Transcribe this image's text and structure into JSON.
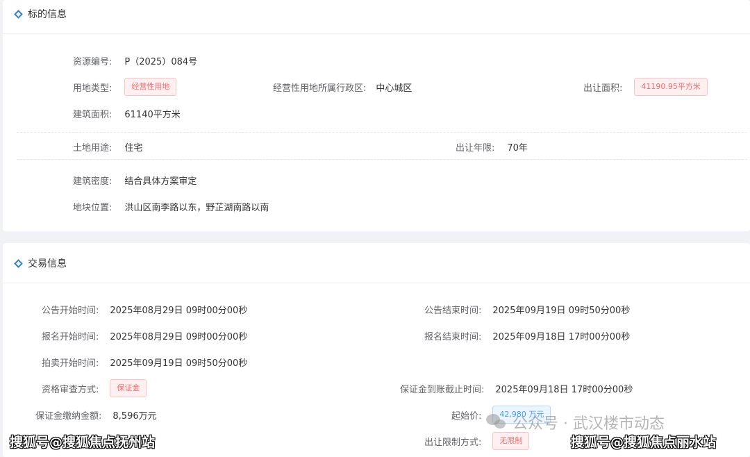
{
  "section1": {
    "title": "标的信息",
    "resource_no": {
      "label": "资源编号:",
      "value": "P（2025）084号"
    },
    "land_type": {
      "label": "用地类型:",
      "value": "经营性用地"
    },
    "district": {
      "label": "经营性用地所属行政区:",
      "value": "中心城区"
    },
    "transfer_area": {
      "label": "出让面积:",
      "value": "41190.95平方米"
    },
    "building_area": {
      "label": "建筑面积:",
      "value": "61140平方米"
    },
    "land_use": {
      "label": "土地用途:",
      "value": "住宅"
    },
    "transfer_years": {
      "label": "出让年限:",
      "value": "70年"
    },
    "building_density": {
      "label": "建筑密度:",
      "value": "结合具体方案审定"
    },
    "location": {
      "label": "地块位置:",
      "value": "洪山区南李路以东，野芷湖南路以南"
    }
  },
  "section2": {
    "title": "交易信息",
    "notice_start": {
      "label": "公告开始时间:",
      "value": "2025年08月29日 09时00分00秒"
    },
    "notice_end": {
      "label": "公告结束时间:",
      "value": "2025年09月19日 09时50分00秒"
    },
    "signup_start": {
      "label": "报名开始时间:",
      "value": "2025年08月29日 09时00分00秒"
    },
    "signup_end": {
      "label": "报名结束时间:",
      "value": "2025年09月18日 17时00分00秒"
    },
    "auction_start": {
      "label": "拍卖开始时间:",
      "value": "2025年09月19日 09时50分00秒"
    },
    "qualification": {
      "label": "资格审查方式:",
      "value": "保证金"
    },
    "deposit_deadline": {
      "label": "保证金到账截止时间:",
      "value": "2025年09月18日 17时00分00秒"
    },
    "deposit_amount": {
      "label": "保证金缴纳金额:",
      "value": "8,596万元"
    },
    "start_price": {
      "label": "起始价:",
      "value": "42,980 万元"
    },
    "restriction": {
      "label": "出让限制方式:",
      "value": "无限制"
    }
  },
  "watermarks": {
    "left": "搜狐号@搜狐焦点抚州站",
    "center": "公众号 · 武汉楼市动态",
    "right": "搜狐号@搜狐焦点丽水站"
  },
  "colors": {
    "accent": "#2f80d8",
    "tag_red": "#f56c6c",
    "tag_blue": "#409eff"
  }
}
